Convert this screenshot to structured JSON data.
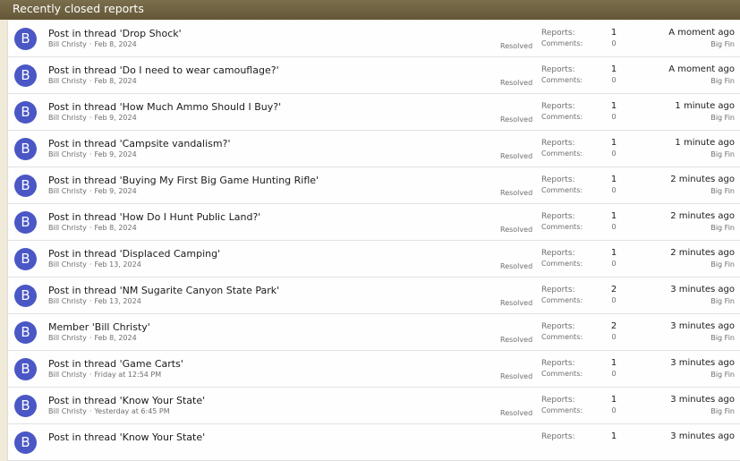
{
  "header": {
    "title": "Recently closed reports"
  },
  "labels": {
    "reports": "Reports:",
    "comments": "Comments:"
  },
  "reports": [
    {
      "avatar": "B",
      "title": "Post in thread 'Drop Shock'",
      "user": "Bill Christy",
      "date": "Feb 8, 2024",
      "status": "Resolved",
      "reports": "1",
      "comments": "0",
      "time": "A moment ago",
      "closed_by": "Big Fin"
    },
    {
      "avatar": "B",
      "title": "Post in thread 'Do I need to wear camouflage?'",
      "user": "Bill Christy",
      "date": "Feb 8, 2024",
      "status": "Resolved",
      "reports": "1",
      "comments": "0",
      "time": "A moment ago",
      "closed_by": "Big Fin"
    },
    {
      "avatar": "B",
      "title": "Post in thread 'How Much Ammo Should I Buy?'",
      "user": "Bill Christy",
      "date": "Feb 9, 2024",
      "status": "Resolved",
      "reports": "1",
      "comments": "0",
      "time": "1 minute ago",
      "closed_by": "Big Fin"
    },
    {
      "avatar": "B",
      "title": "Post in thread 'Campsite vandalism?'",
      "user": "Bill Christy",
      "date": "Feb 9, 2024",
      "status": "Resolved",
      "reports": "1",
      "comments": "0",
      "time": "1 minute ago",
      "closed_by": "Big Fin"
    },
    {
      "avatar": "B",
      "title": "Post in thread 'Buying My First Big Game Hunting Rifle'",
      "user": "Bill Christy",
      "date": "Feb 9, 2024",
      "status": "Resolved",
      "reports": "1",
      "comments": "0",
      "time": "2 minutes ago",
      "closed_by": "Big Fin"
    },
    {
      "avatar": "B",
      "title": "Post in thread 'How Do I Hunt Public Land?'",
      "user": "Bill Christy",
      "date": "Feb 8, 2024",
      "status": "Resolved",
      "reports": "1",
      "comments": "0",
      "time": "2 minutes ago",
      "closed_by": "Big Fin"
    },
    {
      "avatar": "B",
      "title": "Post in thread 'Displaced Camping'",
      "user": "Bill Christy",
      "date": "Feb 13, 2024",
      "status": "Resolved",
      "reports": "1",
      "comments": "0",
      "time": "2 minutes ago",
      "closed_by": "Big Fin"
    },
    {
      "avatar": "B",
      "title": "Post in thread 'NM Sugarite Canyon State Park'",
      "user": "Bill Christy",
      "date": "Feb 13, 2024",
      "status": "Resolved",
      "reports": "2",
      "comments": "0",
      "time": "3 minutes ago",
      "closed_by": "Big Fin"
    },
    {
      "avatar": "B",
      "title": "Member 'Bill Christy'",
      "user": "Bill Christy",
      "date": "Feb 8, 2024",
      "status": "Resolved",
      "reports": "2",
      "comments": "0",
      "time": "3 minutes ago",
      "closed_by": "Big Fin"
    },
    {
      "avatar": "B",
      "title": "Post in thread 'Game Carts'",
      "user": "Bill Christy",
      "date": "Friday at 12:54 PM",
      "status": "Resolved",
      "reports": "1",
      "comments": "0",
      "time": "3 minutes ago",
      "closed_by": "Big Fin"
    },
    {
      "avatar": "B",
      "title": "Post in thread 'Know Your State'",
      "user": "Bill Christy",
      "date": "Yesterday at 6:45 PM",
      "status": "Resolved",
      "reports": "1",
      "comments": "0",
      "time": "3 minutes ago",
      "closed_by": "Big Fin"
    },
    {
      "avatar": "B",
      "title": "Post in thread 'Know Your State'",
      "user": "",
      "date": "",
      "status": "",
      "reports": "1",
      "comments": "",
      "time": "3 minutes ago",
      "closed_by": ""
    }
  ]
}
